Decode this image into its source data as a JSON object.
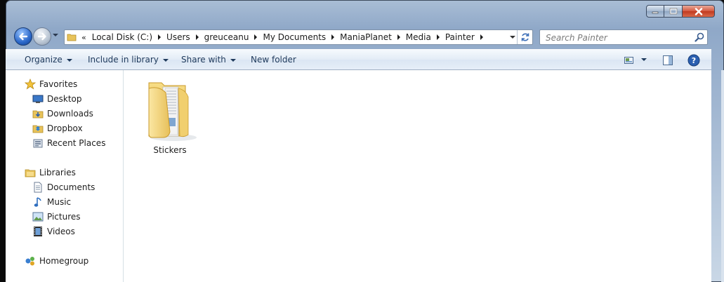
{
  "window": {
    "caption_buttons": {
      "minimize_icon": "minimize-icon",
      "maximize_icon": "maximize-icon",
      "close_icon": "close-icon"
    }
  },
  "navigation": {
    "back_icon": "back-arrow-icon",
    "forward_icon": "forward-arrow-icon",
    "breadcrumb_overflow": "«",
    "breadcrumbs": [
      "Local Disk (C:)",
      "Users",
      "greuceanu",
      "My Documents",
      "ManiaPlanet",
      "Media",
      "Painter"
    ]
  },
  "search": {
    "placeholder": "Search Painter",
    "value": ""
  },
  "commands": {
    "organize": "Organize",
    "include_in_library": "Include in library",
    "share_with": "Share with",
    "new_folder": "New folder"
  },
  "sidebar": {
    "favorites": {
      "label": "Favorites",
      "items": [
        {
          "label": "Desktop",
          "icon": "desktop-icon"
        },
        {
          "label": "Downloads",
          "icon": "downloads-folder-icon"
        },
        {
          "label": "Dropbox",
          "icon": "dropbox-icon"
        },
        {
          "label": "Recent Places",
          "icon": "recent-places-icon"
        }
      ]
    },
    "libraries": {
      "label": "Libraries",
      "items": [
        {
          "label": "Documents",
          "icon": "documents-icon"
        },
        {
          "label": "Music",
          "icon": "music-icon"
        },
        {
          "label": "Pictures",
          "icon": "pictures-icon"
        },
        {
          "label": "Videos",
          "icon": "videos-icon"
        }
      ]
    },
    "homegroup": {
      "label": "Homegroup",
      "icon": "homegroup-icon"
    }
  },
  "files": [
    {
      "name": "Stickers",
      "type": "folder",
      "icon": "folder-icon"
    }
  ],
  "colors": {
    "accent": "#2b67c9",
    "close_button": "#c13a1f",
    "command_text": "#1e395b"
  }
}
